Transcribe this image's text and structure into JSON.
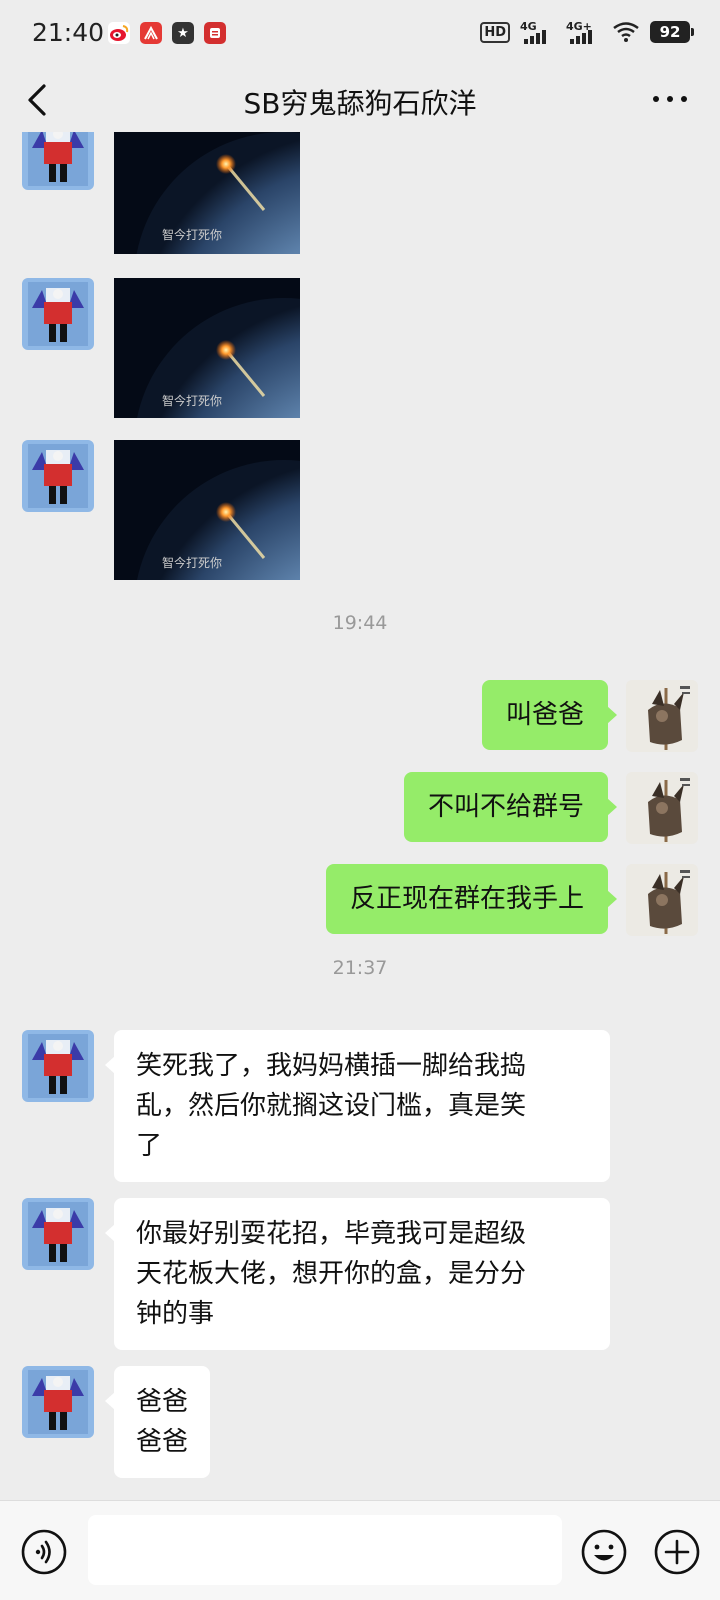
{
  "status_bar": {
    "time": "21:40",
    "hd_label": "HD",
    "network_1": "4G",
    "network_2": "4G+",
    "battery": "92",
    "notification_icons": [
      "weibo-icon",
      "app-icon",
      "star-icon",
      "news-icon"
    ]
  },
  "nav": {
    "title": "SB穷鬼舔狗石欣洋"
  },
  "chat": {
    "image_caption": "智今打死你",
    "timestamps": [
      "19:44",
      "21:37"
    ],
    "sent_messages": [
      {
        "text": "叫爸爸"
      },
      {
        "text": "不叫不给群号"
      },
      {
        "text": "反正现在群在我手上"
      }
    ],
    "received_messages": [
      {
        "lines": [
          "笑死我了，我妈妈横插一脚给我捣",
          "乱，然后你就搁这设门槛，真是笑",
          "了"
        ]
      },
      {
        "lines": [
          "你最好别耍花招，毕竟我可是超级",
          "天花板大佬，想开你的盒，是分分",
          "钟的事"
        ]
      },
      {
        "lines": [
          "爸爸",
          "爸爸"
        ]
      }
    ]
  },
  "input_bar": {
    "placeholder": "",
    "icons": [
      "voice-icon",
      "emoji-icon",
      "plus-icon"
    ]
  },
  "colors": {
    "background": "#ededed",
    "sent_bubble": "#95ec69",
    "received_bubble": "#ffffff"
  }
}
